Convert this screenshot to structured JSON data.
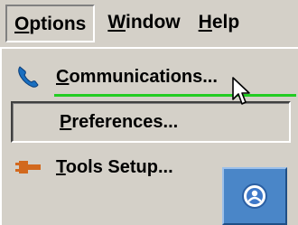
{
  "menubar": {
    "options": {
      "mnemonic": "O",
      "rest": "ptions"
    },
    "window": {
      "mnemonic": "W",
      "rest": "indow"
    },
    "help": {
      "mnemonic": "H",
      "rest": "elp"
    }
  },
  "menu": {
    "items": [
      {
        "mnemonic": "C",
        "rest": "ommunications...",
        "icon": "phone-handset-icon",
        "highlighted": false
      },
      {
        "mnemonic": "P",
        "rest": "references...",
        "icon": "",
        "highlighted": true
      },
      {
        "mnemonic": "T",
        "rest": "ools Setup...",
        "icon": "plug-connector-icon",
        "highlighted": false
      }
    ]
  },
  "taskbar": {
    "icon": "user-circle-icon"
  },
  "colors": {
    "menu_bg": "#d4d0c8",
    "separator": "#22cc22",
    "phone_icon": "#1a6fc0",
    "plug_icon": "#d2691e",
    "task_button": "#4a86c8"
  }
}
